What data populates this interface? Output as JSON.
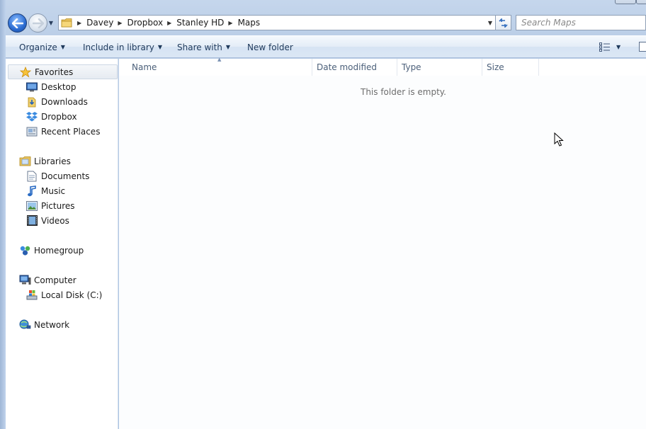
{
  "window": {
    "title_visible": false
  },
  "navigation": {
    "breadcrumb": [
      "Davey",
      "Dropbox",
      "Stanley HD",
      "Maps"
    ],
    "search_placeholder": "Search Maps"
  },
  "toolbar": {
    "organize": "Organize",
    "include_in_library": "Include in library",
    "share_with": "Share with",
    "new_folder": "New folder"
  },
  "sidebar": {
    "favorites": {
      "label": "Favorites",
      "items": [
        "Desktop",
        "Downloads",
        "Dropbox",
        "Recent Places"
      ]
    },
    "libraries": {
      "label": "Libraries",
      "items": [
        "Documents",
        "Music",
        "Pictures",
        "Videos"
      ]
    },
    "homegroup": {
      "label": "Homegroup"
    },
    "computer": {
      "label": "Computer",
      "items": [
        "Local Disk (C:)"
      ]
    },
    "network": {
      "label": "Network"
    }
  },
  "content": {
    "columns": [
      "Name",
      "Date modified",
      "Type",
      "Size"
    ],
    "empty_message": "This folder is empty."
  },
  "colors": {
    "accent": "#1e395b",
    "selected_bg": "#e6ebf1",
    "frame": "#b9cde6"
  }
}
